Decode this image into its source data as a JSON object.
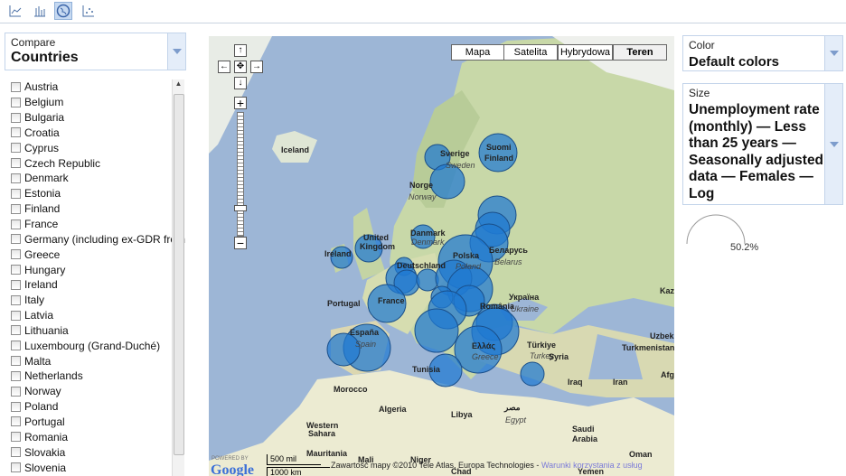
{
  "toolbar": {
    "icons": [
      "line-chart-icon",
      "bar-chart-icon",
      "map-icon",
      "scatter-icon"
    ],
    "selected": "map-icon"
  },
  "compare": {
    "label": "Compare",
    "value": "Countries"
  },
  "countries": [
    "Austria",
    "Belgium",
    "Bulgaria",
    "Croatia",
    "Cyprus",
    "Czech Republic",
    "Denmark",
    "Estonia",
    "Finland",
    "France",
    "Germany (including ex-GDR from",
    "Greece",
    "Hungary",
    "Ireland",
    "Italy",
    "Latvia",
    "Lithuania",
    "Luxembourg (Grand-Duché)",
    "Malta",
    "Netherlands",
    "Norway",
    "Poland",
    "Portugal",
    "Romania",
    "Slovakia",
    "Slovenia"
  ],
  "map": {
    "types": [
      "Mapa",
      "Satelita",
      "Hybrydowa",
      "Teren"
    ],
    "selected_type": "Teren",
    "zoom_level_fraction": 0.2,
    "labels": {
      "iceland": "Iceland",
      "sverige": "Sverige",
      "sweden": "Sweden",
      "suomi": "Suomi",
      "finland": "Finland",
      "norge": "Norge",
      "norway": "Norway",
      "uk1": "United",
      "uk2": "Kingdom",
      "ireland": "Ireland",
      "danmark": "Danmark",
      "denmark": "Denmark",
      "deutschland": "Deutschland",
      "polska": "Polska",
      "poland": "Poland",
      "belarus_ru": "Беларусь",
      "belarus": "Belarus",
      "ukraina": "Україна",
      "ukraine": "Ukraine",
      "france": "France",
      "romania": "România",
      "espana": "España",
      "spain": "Spain",
      "portugal": "Portugal",
      "greece_gr": "Ελλάς",
      "greece": "Greece",
      "turkiye": "Türkiye",
      "turkey": "Turkey",
      "syria": "Syria",
      "iraq": "Iraq",
      "iran": "Iran",
      "kaz": "Kaz",
      "uzbek": "Uzbeki",
      "turkmen": "Turkmenistan",
      "afgh": "Afgh",
      "tunisia": "Tunisia",
      "morocco": "Morocco",
      "algeria": "Algeria",
      "libya": "Libya",
      "egypt_ar": "مصر",
      "egypt": "Egypt",
      "saudi1": "Saudi",
      "saudi2": "Arabia",
      "oman": "Oman",
      "wsahara1": "Western",
      "wsahara2": "Sahara",
      "mauritania": "Mauritania",
      "mali": "Mali",
      "niger": "Niger",
      "chad": "Chad",
      "yemen": "Yemen"
    },
    "scale_mi": "500 mil",
    "scale_km": "1000 km",
    "powered_by": "POWERED BY",
    "google": "Google",
    "copyright": "Zawartość mapy ©2010 Tele Atlas, Europa Technologies -",
    "terms": "Warunki korzystania z usług",
    "bubble_color": "#1f78d1"
  },
  "color": {
    "label": "Color",
    "value": "Default colors"
  },
  "size": {
    "label": "Size",
    "value": "Unemployment rate (monthly) — Less than 25 years — Seasonally adjusted data — Females — Log"
  },
  "size_legend": {
    "value": "50.2%"
  }
}
